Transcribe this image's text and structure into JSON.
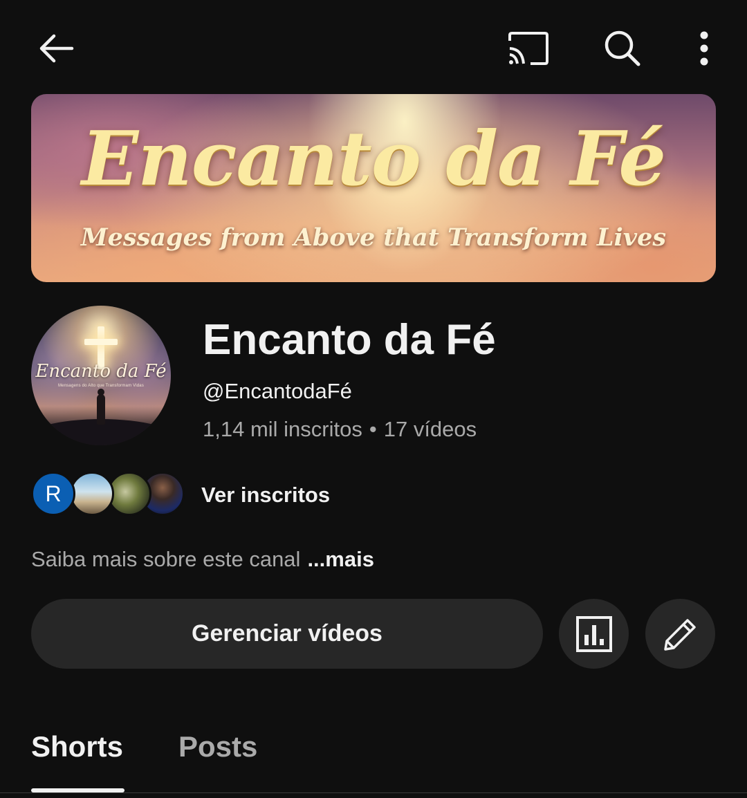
{
  "topbar": {
    "back_icon": "arrow-left-icon",
    "cast_icon": "cast-icon",
    "search_icon": "search-icon",
    "more_icon": "more-vertical-icon"
  },
  "banner": {
    "title": "Encanto da Fé",
    "subtitle": "Messages from Above that Transform Lives"
  },
  "avatar": {
    "text": "Encanto da Fé",
    "subtext": "Mensagens do Alto que Transformam Vidas"
  },
  "channel": {
    "name": "Encanto da Fé",
    "handle": "@EncantodaFé",
    "subscribers": "1,14 mil inscritos",
    "separator": "•",
    "videos": "17 vídeos"
  },
  "subscribers_preview": {
    "first_initial": "R",
    "link_label": "Ver inscritos"
  },
  "about": {
    "text": "Saiba mais sobre este canal",
    "more_label": "...mais"
  },
  "actions": {
    "manage_label": "Gerenciar vídeos",
    "analytics_icon": "analytics-icon",
    "edit_icon": "pencil-icon"
  },
  "tabs": [
    {
      "label": "Shorts",
      "active": true
    },
    {
      "label": "Posts",
      "active": false
    }
  ],
  "colors": {
    "background": "#0f0f0f",
    "button_bg": "#272727",
    "primary_text": "#f1f1f1",
    "secondary_text": "#aaaaaa",
    "subscriber_avatar": "#0b5fb3"
  }
}
